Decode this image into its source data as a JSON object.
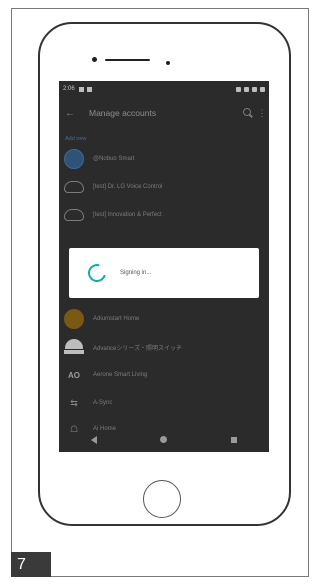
{
  "status_bar": {
    "time": "2:06"
  },
  "app_bar": {
    "back": "←",
    "title": "Manage accounts",
    "more": "⋮"
  },
  "list": {
    "add_new": "Add new",
    "items": [
      {
        "label": "@Nobuo Smart",
        "icon": "avatar-icon"
      },
      {
        "label": "[test] Dr. LG Voice Control",
        "icon": "cloud-icon"
      },
      {
        "label": "[test] Innovation & Perfect",
        "icon": "cloud-icon"
      },
      {
        "label": "Adiumstart Home",
        "icon": "avatar-icon"
      },
      {
        "label": "Advanceシリーズ・照明スイッチ",
        "icon": "helmet-icon"
      },
      {
        "label": "Aerone Smart Living",
        "icon": "logo-icon",
        "icon_text": "AO"
      },
      {
        "label": "A-Sync",
        "icon": "logo-icon",
        "icon_text": "⇆"
      },
      {
        "label": "Ai Home",
        "icon": "logo-icon",
        "icon_text": "☖"
      }
    ]
  },
  "dialog": {
    "message": "Signing in..."
  },
  "step_number": "7",
  "colors": {
    "accent": "#00b4aa",
    "link": "#3e6fa8",
    "screen_bg": "#2b2b2b"
  }
}
